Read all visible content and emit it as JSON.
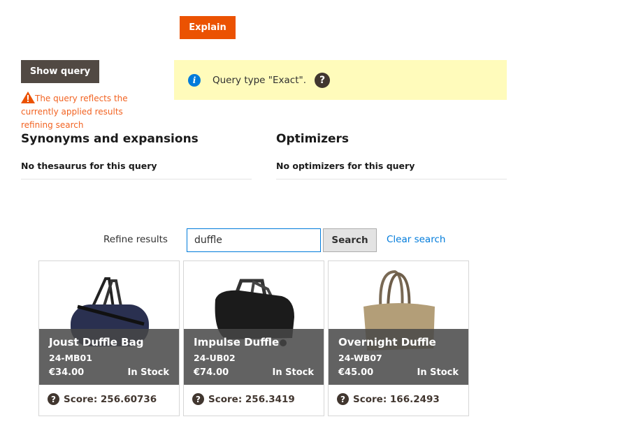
{
  "toolbar": {
    "explain_label": "Explain",
    "show_query_label": "Show query"
  },
  "warning": {
    "text": "The query reflects the currently applied results refining search"
  },
  "notice": {
    "text": "Query type \"Exact\"."
  },
  "synonyms": {
    "title": "Synonyms and expansions",
    "text": "No thesaurus for this query"
  },
  "optimizers": {
    "title": "Optimizers",
    "text": "No optimizers for this query"
  },
  "refine": {
    "label": "Refine results",
    "value": "duffle",
    "search_label": "Search",
    "clear_label": "Clear search"
  },
  "products": [
    {
      "name": "Joust Duffle Bag",
      "sku": "24-MB01",
      "price": "€34.00",
      "stock": "In Stock",
      "score": "Score: 256.60736"
    },
    {
      "name": "Impulse Duffle",
      "sku": "24-UB02",
      "price": "€74.00",
      "stock": "In Stock",
      "score": "Score: 256.3419"
    },
    {
      "name": "Overnight Duffle",
      "sku": "24-WB07",
      "price": "€45.00",
      "stock": "In Stock",
      "score": "Score: 166.2493"
    }
  ],
  "colors": {
    "accent": "#eb5202",
    "dark": "#514943",
    "link": "#007bdb",
    "notice": "#fffbbb"
  }
}
